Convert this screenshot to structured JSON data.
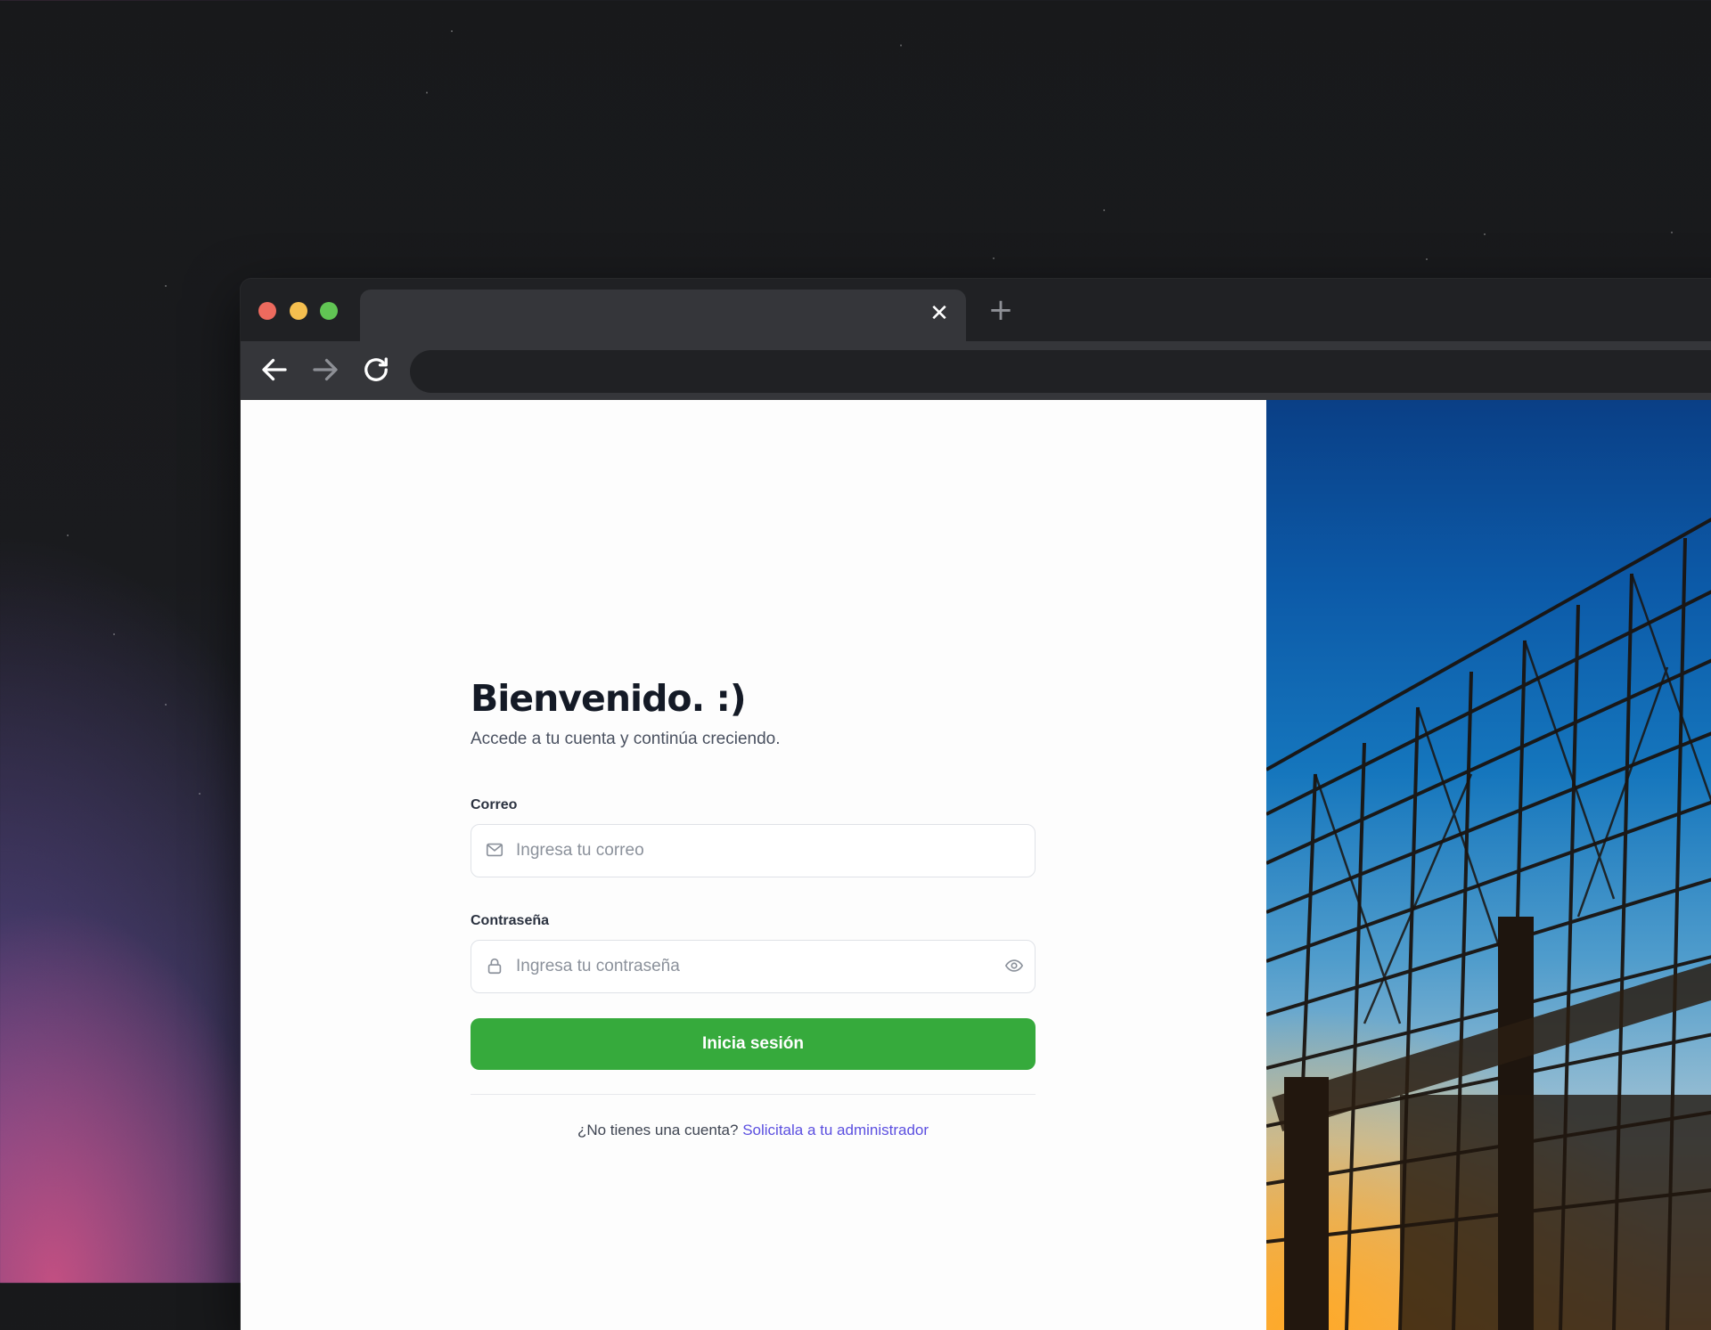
{
  "browser": {
    "tab_close_glyph": "✕",
    "new_tab_glyph": "+"
  },
  "login": {
    "title": "Bienvenido. :)",
    "subtitle": "Accede a tu cuenta y continúa creciendo.",
    "email": {
      "label": "Correo",
      "placeholder": "Ingresa tu correo",
      "value": ""
    },
    "password": {
      "label": "Contraseña",
      "placeholder": "Ingresa tu contraseña",
      "value": ""
    },
    "submit_label": "Inicia sesión",
    "signup_prompt": "¿No tienes una cuenta?",
    "signup_link": "Solicitala a tu administrador"
  },
  "icons": {
    "email": "mail-icon",
    "password": "lock-icon",
    "toggle_password": "eye-icon",
    "back": "arrow-left-icon",
    "forward": "arrow-right-icon",
    "reload": "reload-icon"
  },
  "colors": {
    "primary_button": "#36aa3c",
    "link": "#5b4fe0",
    "title": "#141a26"
  }
}
